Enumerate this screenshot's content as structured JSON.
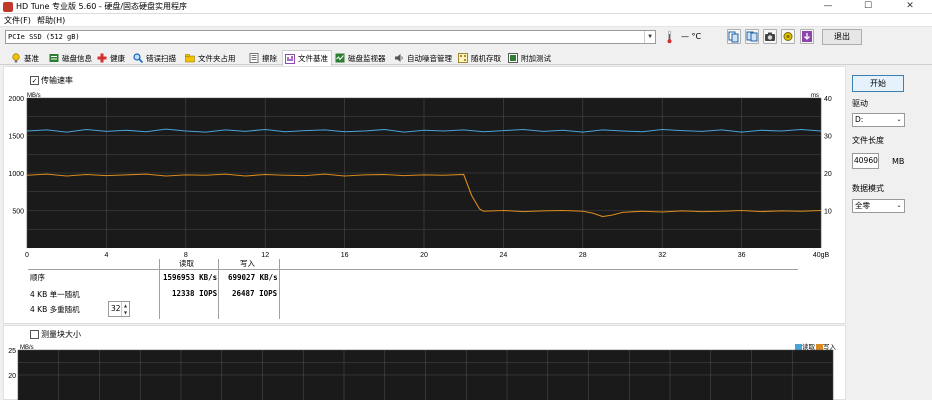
{
  "window": {
    "title": "HD Tune 专业版 5.60 - 硬盘/固态硬盘实用程序",
    "minimize": "—",
    "maximize": "☐",
    "close": "✕"
  },
  "menu": [
    "文件(F)",
    "帮助(H)"
  ],
  "drive": {
    "selected": "PCIe SSD (512 gB)",
    "temperature": "— °C"
  },
  "toolbar": {
    "exit_label": "退出"
  },
  "tabs": [
    {
      "label": "基准",
      "icon": "benchmark-icon",
      "color": "#e0b000"
    },
    {
      "label": "磁盘信息",
      "icon": "disk-info-icon",
      "color": "#2e7d32"
    },
    {
      "label": "健康",
      "icon": "health-cross-icon",
      "color": "#d32f2f"
    },
    {
      "label": "错误扫描",
      "icon": "error-scan-icon",
      "color": "#1565c0"
    },
    {
      "label": "文件夹占用",
      "icon": "folder-usage-icon",
      "color": "#e0a000"
    },
    {
      "label": "擦除",
      "icon": "erase-icon",
      "color": "#555555"
    },
    {
      "label": "文件基准",
      "icon": "file-benchmark-icon",
      "color": "#7b1fa2"
    },
    {
      "label": "磁盘监视器",
      "icon": "disk-monitor-icon",
      "color": "#2e7d32"
    },
    {
      "label": "自动噪音管理",
      "icon": "noise-speaker-icon",
      "color": "#555555"
    },
    {
      "label": "随机存取",
      "icon": "random-access-icon",
      "color": "#e0a000"
    },
    {
      "label": "附加测试",
      "icon": "extra-tests-icon",
      "color": "#2e7d32"
    }
  ],
  "transfer": {
    "checkbox_label": "传输速率",
    "checked": true
  },
  "results": {
    "read_header": "读取",
    "write_header": "写入",
    "rows": [
      {
        "label": "顺序",
        "read": "1596953 KB/s",
        "write": "699027 KB/s"
      },
      {
        "label": "4 KB 单一随机",
        "read": "12338 IOPS",
        "write": "26487 IOPS"
      },
      {
        "label": "4 KB 多重随机",
        "read": "",
        "write": ""
      }
    ],
    "queue_depth": "32"
  },
  "side": {
    "start_label": "开始",
    "drive_label": "驱动",
    "drive_value": "D:",
    "length_label": "文件长度",
    "length_value": "40960",
    "length_unit": "MB",
    "pattern_label": "数据模式",
    "pattern_value": "全零"
  },
  "block_size": {
    "checkbox_label": "测量块大小",
    "legend_read": "读取",
    "legend_write": "写入"
  },
  "chart_data": [
    {
      "type": "line",
      "ylabel": "MB/s",
      "y2label": "ms",
      "x_unit": "gB",
      "xlim": [
        0,
        40
      ],
      "ylim": [
        0,
        2000
      ],
      "y2lim": [
        0,
        40
      ],
      "y_ticks": [
        "2000",
        "1500",
        "1000",
        "500"
      ],
      "y2_ticks": [
        "40",
        "30",
        "20",
        "10"
      ],
      "x_ticks": [
        "0",
        "4",
        "8",
        "12",
        "16",
        "20",
        "24",
        "28",
        "32",
        "36",
        "40gB"
      ],
      "grid": true,
      "background": "#1a1a1a",
      "series": [
        {
          "color": "#4aa3d8",
          "x": [
            0,
            1,
            2,
            3,
            4,
            5,
            6,
            7,
            8,
            9,
            10,
            11,
            12,
            13,
            14,
            15,
            16,
            17,
            18,
            19,
            20,
            21,
            22,
            23,
            24,
            25,
            26,
            27,
            28,
            29,
            30,
            31,
            32,
            33,
            34,
            35,
            36,
            37,
            38,
            39,
            40
          ],
          "values": [
            1560,
            1575,
            1545,
            1580,
            1555,
            1570,
            1550,
            1585,
            1560,
            1545,
            1575,
            1555,
            1580,
            1550,
            1565,
            1575,
            1550,
            1560,
            1580,
            1545,
            1570,
            1560,
            1575,
            1550,
            1565,
            1580,
            1555,
            1570,
            1545,
            1575,
            1560,
            1550,
            1580,
            1565,
            1555,
            1575,
            1545,
            1570,
            1560,
            1580,
            1560
          ]
        },
        {
          "color": "#d98a1e",
          "x": [
            0,
            1,
            2,
            3,
            4,
            5,
            6,
            7,
            8,
            9,
            10,
            11,
            12,
            13,
            14,
            15,
            16,
            17,
            18,
            19,
            20,
            21,
            22,
            22.4,
            22.8,
            23,
            24,
            25,
            26,
            27,
            28,
            28.5,
            29,
            29.5,
            30,
            31,
            32,
            33,
            34,
            35,
            36,
            37,
            38,
            39,
            40
          ],
          "values": [
            970,
            985,
            960,
            980,
            965,
            975,
            985,
            960,
            975,
            970,
            985,
            960,
            980,
            970,
            965,
            985,
            960,
            975,
            980,
            965,
            975,
            970,
            980,
            700,
            520,
            490,
            500,
            485,
            495,
            500,
            490,
            465,
            420,
            440,
            475,
            490,
            480,
            495,
            485,
            490,
            500,
            485,
            495,
            490,
            500
          ]
        }
      ]
    },
    {
      "type": "bar",
      "ylabel": "MB/s",
      "ylim": [
        0,
        25
      ],
      "y_ticks": [
        "25",
        "20"
      ],
      "series": [
        {
          "name": "读取",
          "values": []
        },
        {
          "name": "写入",
          "values": []
        }
      ]
    }
  ],
  "colors": {
    "read": "#4aa3d8",
    "write": "#d98a1e",
    "chart_bg": "#1a1a1a",
    "grid": "#4a4a4a",
    "accent_button": "#3c7fb1"
  }
}
